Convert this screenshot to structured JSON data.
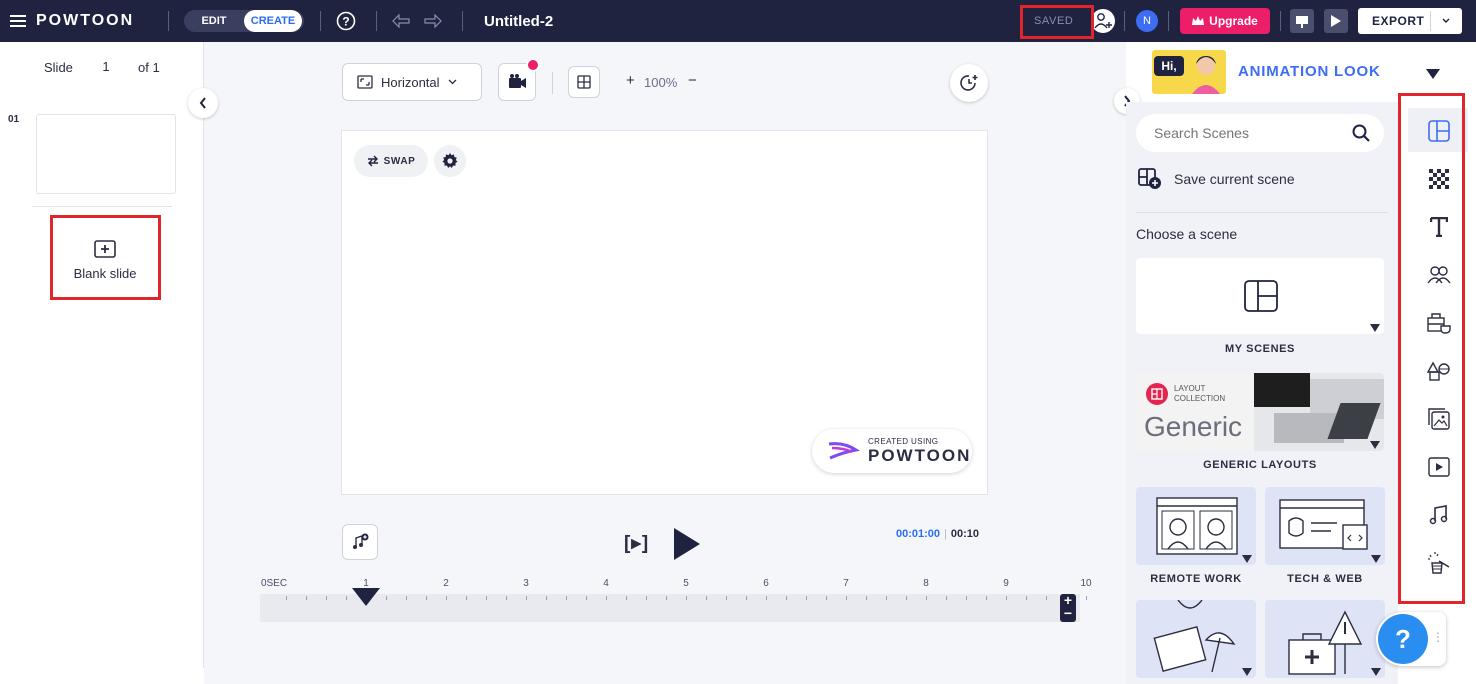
{
  "topbar": {
    "brand": "POWTOON",
    "edit_label": "EDIT",
    "create_label": "CREATE",
    "title": "Untitled-2",
    "saved_label": "SAVED",
    "avatar_initial": "N",
    "upgrade_label": "Upgrade",
    "export_label": "EXPORT"
  },
  "slides": {
    "slide_label": "Slide",
    "current": "1",
    "of_label": "of 1",
    "thumb_number": "01",
    "blank_label": "Blank slide"
  },
  "toolbar": {
    "orientation": "Horizontal",
    "zoom_label": "100%"
  },
  "canvas": {
    "swap_label": "SWAP",
    "watermark_top": "CREATED USING",
    "watermark_brand": "POWTOON"
  },
  "player": {
    "time_current": "00:01:00",
    "time_total": "00:10",
    "bracket_play": "[▸]"
  },
  "timeline": {
    "start_label": "0SEC",
    "ticks": [
      "1",
      "2",
      "3",
      "4",
      "5",
      "6",
      "7",
      "8",
      "9",
      "10"
    ],
    "playhead_seconds": 1
  },
  "right": {
    "look_title": "ANIMATION LOOK",
    "look_badge": "Hi,",
    "search_placeholder": "Search Scenes",
    "save_scene_label": "Save current scene",
    "choose_label": "Choose a scene",
    "my_scenes_label": "MY SCENES",
    "layout_small_1": "LAYOUT",
    "layout_small_2": "COLLECTION",
    "layout_generic": "Generic",
    "generic_layouts_label": "GENERIC LAYOUTS",
    "remote_work_label": "REMOTE WORK",
    "tech_web_label": "TECH & WEB",
    "help_label": "?"
  },
  "colors": {
    "topbar": "#1f2340",
    "accent_blue": "#2a6df4",
    "upgrade_pink": "#ec1e6a",
    "highlight_red": "#e0252d",
    "card_lavender": "#dfe3f6"
  }
}
